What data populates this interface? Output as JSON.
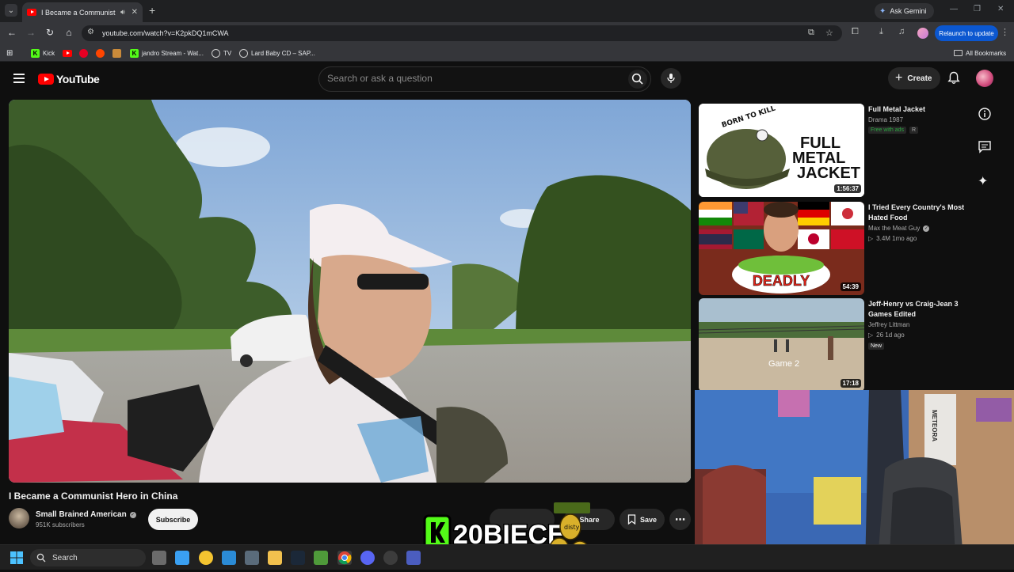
{
  "browser": {
    "tab_title": "I Became a Communist Hero in China",
    "ask_gemini": "Ask Gemini",
    "url": "youtube.com/watch?v=K2pkDQ1mCWA",
    "relaunch": "Relaunch to update",
    "bookmarks": [
      "Kick",
      "jandro Stream - Wat...",
      "TV",
      "Lard Baby CD – SAP...",
      "All Bookmarks"
    ]
  },
  "youtube": {
    "logo": "YouTube",
    "search_placeholder": "Search or ask a question",
    "create": "Create",
    "video_title": "I Became a Communist Hero in China",
    "channel": {
      "name": "Small Brained American",
      "subs": "951K subscribers"
    },
    "subscribe": "Subscribe",
    "actions": {
      "share": "Share",
      "save": "Save"
    },
    "recommendations": [
      {
        "title": "Full Metal Jacket",
        "meta": "Drama 1987",
        "badges": [
          "Free with ads",
          "R"
        ],
        "duration": "1:56:37",
        "thumb_text": "FULL METAL JACKET",
        "helmet_text": "BORN TO KILL"
      },
      {
        "title": "I Tried Every Country's Most Hated Food",
        "channel": "Max the Meat Guy",
        "stats": "3.4M  1mo ago",
        "duration": "54:39",
        "thumb_text": "DEADLY"
      },
      {
        "title": "Jeff-Henry vs Craig-Jean 3 Games Edited",
        "channel": "Jeffrey Littman",
        "stats": "26  1d ago",
        "badge": "New",
        "duration": "17:18",
        "thumb_text": "Game 2"
      }
    ]
  },
  "overlay": {
    "kick_handle": "20BIECE",
    "can_text": "disty"
  },
  "webcam": {
    "poster_text": "METEORA"
  },
  "taskbar": {
    "search": "Search"
  },
  "colors": {
    "yt_red": "#ff0000",
    "kick_green": "#53fc18",
    "relaunch_blue": "#0b57d0"
  }
}
